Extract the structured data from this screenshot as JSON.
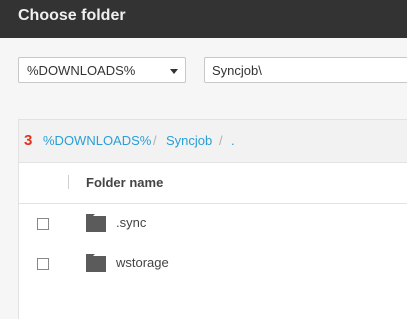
{
  "dialog": {
    "title": "Choose folder"
  },
  "root_select": {
    "value": "%DOWNLOADS%"
  },
  "path_input": {
    "value": "Syncjob\\"
  },
  "breadcrumb": {
    "badge": "3",
    "items": [
      {
        "label": "%DOWNLOADS%"
      },
      {
        "label": "Syncjob"
      },
      {
        "label": "."
      }
    ],
    "separator": "/"
  },
  "table": {
    "column_header": "Folder name",
    "rows": [
      {
        "name": ".sync",
        "icon": "folder-icon"
      },
      {
        "name": "wstorage",
        "icon": "folder-icon"
      }
    ]
  },
  "colors": {
    "titlebar": "#333333",
    "link": "#2a9fd6",
    "badge": "#e0321e",
    "folder": "#5b5b5b"
  }
}
